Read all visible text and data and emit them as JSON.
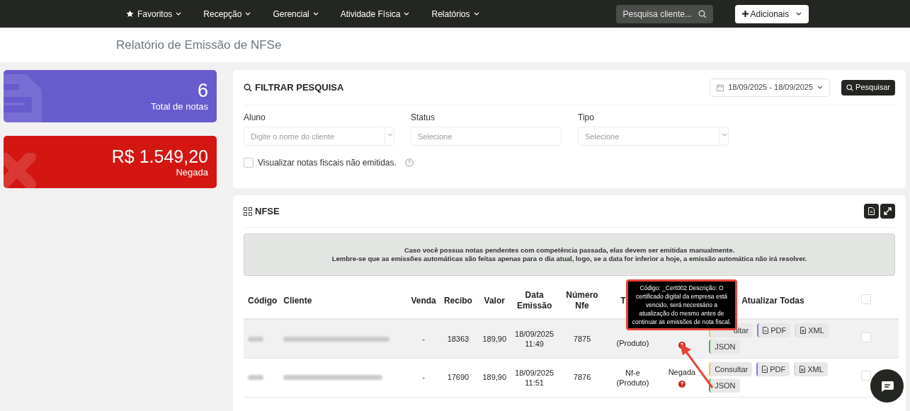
{
  "nav": {
    "items": [
      {
        "label": "Favoritos",
        "starred": true
      },
      {
        "label": "Recepção",
        "starred": false
      },
      {
        "label": "Gerencial",
        "starred": false
      },
      {
        "label": "Atividade Física",
        "starred": false
      },
      {
        "label": "Relatórios",
        "starred": false
      }
    ],
    "search_placeholder": "Pesquisa cliente...",
    "add_button": "Adicionais"
  },
  "page_title": "Relatório de Emissão de NFSe",
  "stats": [
    {
      "kind": "document",
      "value": "6",
      "label": "Total de notas",
      "color": "#675bcd"
    },
    {
      "kind": "denied",
      "value": "R$ 1.549,20",
      "label": "Negada",
      "color": "#d31612"
    }
  ],
  "filter": {
    "title": "FILTRAR PESQUISA",
    "date_range": "18/09/2025 - 18/09/2025",
    "search_button": "Pesquisar",
    "fields": [
      {
        "label": "Aluno",
        "placeholder": "Digite o nome do cliente",
        "kind": "select"
      },
      {
        "label": "Status",
        "placeholder": "Selecione",
        "kind": "input"
      },
      {
        "label": "Tipo",
        "placeholder": "Selecione",
        "kind": "select"
      }
    ],
    "checkbox": {
      "label": "Visualizar notas fiscais não emitidas.",
      "checked": false
    }
  },
  "nfse": {
    "title": "NFSE",
    "notice": [
      "Caso você possua notas pendentes com competência passada, elas devem ser emitidas manualmente.",
      "Lembre-se que as emissões automáticas são feitas apenas para o dia atual, logo, se a data for inferior a hoje, a emissão automática não irá resolver."
    ],
    "columns": [
      "Código",
      "Cliente",
      "Venda",
      "Recibo",
      "Valor",
      "Data Emissão",
      "Número Nfe",
      "T",
      "",
      "Atualizar Todas"
    ],
    "select_all": {
      "checked": false
    },
    "rows": [
      {
        "venda": "-",
        "recibo": "18363",
        "valor": "189,90",
        "data": "18/09/2025",
        "hora": "11:49",
        "numero": "7875",
        "tipo": "(Produto)",
        "help": true,
        "selected": true,
        "checked": false,
        "actions": [
          {
            "kind": "consult",
            "label": "ultar",
            "color": "#f2c94c"
          },
          {
            "kind": "pdf",
            "label": "PDF",
            "color": "#8a7bd8"
          },
          {
            "kind": "xml",
            "label": "XML",
            "color": "#dcdcdc"
          },
          {
            "kind": "json",
            "label": "JSON",
            "color": "#4caf50"
          }
        ]
      },
      {
        "venda": "-",
        "recibo": "17690",
        "valor": "189,90",
        "data": "18/09/2025",
        "hora": "11:51",
        "numero": "7876",
        "tipo": "Nf-e (Produto)",
        "status": "Negada",
        "help": true,
        "selected": false,
        "checked": false,
        "actions": [
          {
            "kind": "consult",
            "label": "Consultar",
            "color": "#f2c94c"
          },
          {
            "kind": "pdf",
            "label": "PDF",
            "color": "#8a7bd8"
          },
          {
            "kind": "xml",
            "label": "XML",
            "color": "#dcdcdc"
          },
          {
            "kind": "json",
            "label": "JSON",
            "color": "#4caf50"
          }
        ]
      }
    ],
    "tooltip": "Código: _Cert002 Descrição: O certificado digital da empresa está vencido, será necessário a atualização do mesmo antes de continuar as emissões de nota fiscal."
  }
}
